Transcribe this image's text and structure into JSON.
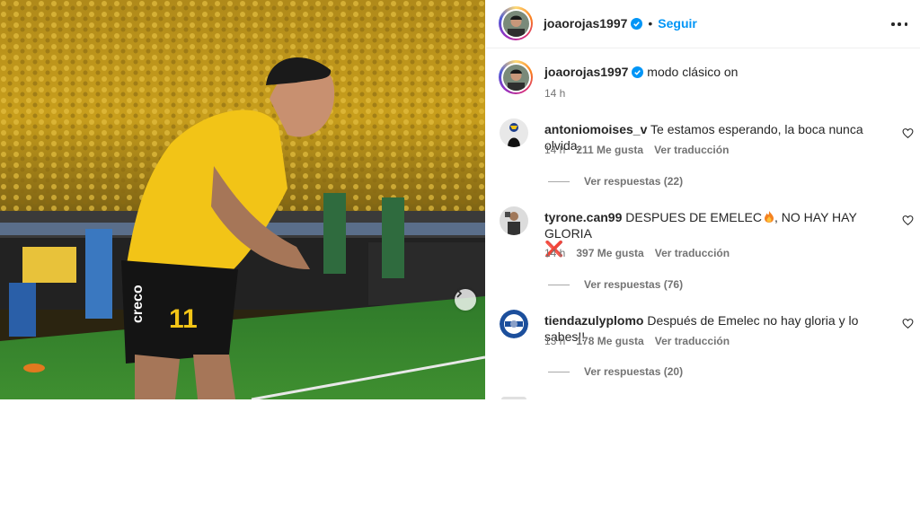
{
  "post": {
    "media": {
      "photo_icon": "player-photo-icon",
      "carousel_next_icon": "chevron-right-icon"
    },
    "header": {
      "username": "joaorojas1997",
      "separator": "•",
      "follow_label": "Seguir",
      "verified_icon": "verified-badge-icon",
      "more_icon": "more-options-icon"
    },
    "caption": {
      "username": "joaorojas1997",
      "text": "modo clásico on",
      "time": "14 h"
    },
    "comments": [
      {
        "username": "antoniomoises_v",
        "text": "Te estamos esperando, la boca nunca olvida.",
        "time": "14 h",
        "likes": "211 Me gusta",
        "translate": "Ver traducción",
        "replies": "Ver respuestas (22)",
        "heart_icon": "heart-outline-icon"
      },
      {
        "username": "tyrone.can99",
        "text": "DESPUES DE EMELEC",
        "text_after": ", NO HAY HAY GLORIA",
        "emoji_1": "fire-emoji",
        "emoji_2": "❌",
        "time": "14 h",
        "likes": "397 Me gusta",
        "translate": "Ver traducción",
        "replies": "Ver respuestas (76)",
        "heart_icon": "heart-outline-icon"
      },
      {
        "username": "tiendazulyplomo",
        "text": "Después de Emelec no hay gloria y lo sabes!!",
        "time": "13 h",
        "likes": "178 Me gusta",
        "translate": "Ver traducción",
        "replies": "Ver respuestas (20)",
        "heart_icon": "heart-outline-icon"
      }
    ]
  },
  "colors": {
    "link_blue": "#0095f6",
    "secondary_text": "#737373",
    "primary_text": "#262626",
    "jersey_yellow": "#f2c417",
    "pitch_green": "#2f7a2a"
  }
}
